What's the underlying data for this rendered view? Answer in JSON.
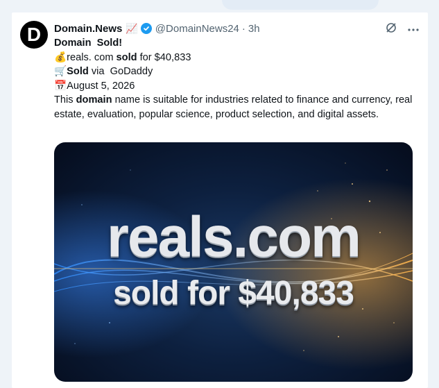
{
  "tweet": {
    "avatar_letter": "D",
    "author_name": "Domain.News",
    "author_badge_emoji": "📈",
    "handle": "@DomainNews24",
    "separator": "·",
    "timestamp": "3h",
    "title_word1": "Domain",
    "title_word2": "Sold!",
    "line_price_emoji": "💰",
    "line_price_pre": "reals. com ",
    "line_price_bold": "sold",
    "line_price_post": " for $40,833",
    "line_via_emoji": "🛒",
    "line_via_bold": "Sold",
    "line_via_post": " via  GoDaddy",
    "line_date_emoji": "📅",
    "line_date": "August 5, 2026",
    "desc_pre": "This ",
    "desc_bold": "domain",
    "desc_post": " name is suitable for industries related to finance and currency, real estate, evaluation, popular science, product selection, and digital assets."
  },
  "media": {
    "headline": "reals.com",
    "subline": "sold for $40,833"
  },
  "colors": {
    "verified": "#1d9bf0",
    "secondary_text": "#536471",
    "media_bg": "#0d203f",
    "glow": "#f5a623"
  },
  "icons": {
    "grok": "grok-icon",
    "more": "more-icon",
    "verified": "verified-badge-icon"
  }
}
